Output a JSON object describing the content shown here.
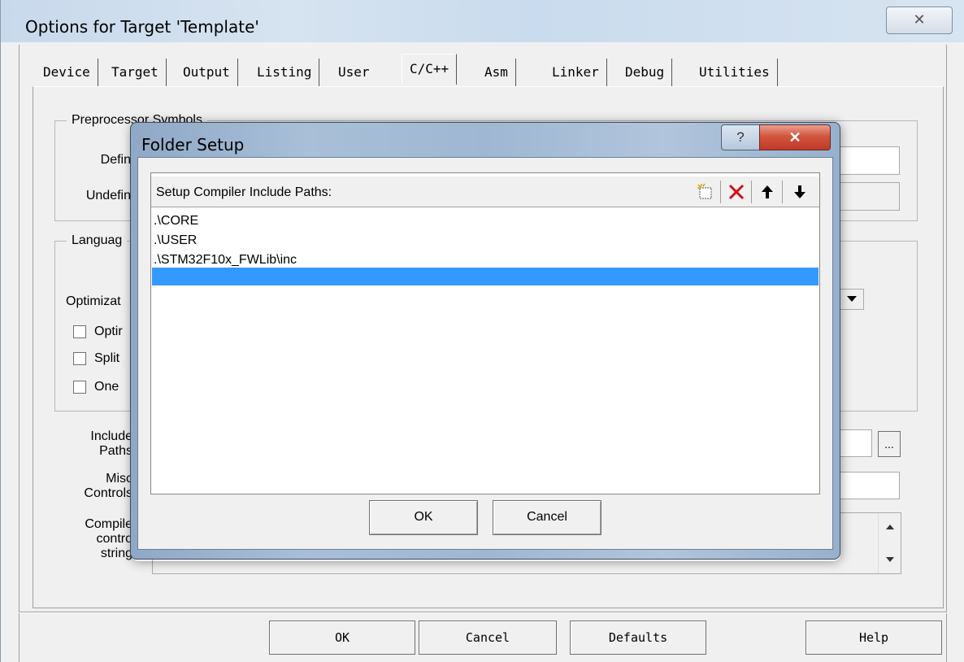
{
  "outer_dialog": {
    "title": "Options for Target 'Template'",
    "close_glyph": "✕",
    "tabs": [
      "Device",
      "Target",
      "Output",
      "Listing",
      "User",
      "C/C++",
      "Asm",
      "Linker",
      "Debug",
      "Utilities"
    ],
    "active_tab": "C/C++",
    "preprocessor_group": {
      "legend": "Preprocessor Symbols",
      "define_label": "Defin",
      "undefine_label": "Undefin"
    },
    "language_group": {
      "legend": "Languag",
      "optimization_label": "Optimizat",
      "checkboxes": [
        "Optir",
        "Split",
        "One"
      ]
    },
    "include_paths_label": [
      "Include",
      "Paths"
    ],
    "misc_controls_label": [
      "Misc",
      "Controls"
    ],
    "compiler_control_label": [
      "Compile",
      "contro",
      "string"
    ],
    "browse_button": "...",
    "buttons": {
      "ok": "OK",
      "cancel": "Cancel",
      "defaults": "Defaults",
      "help": "Help"
    }
  },
  "folder_setup": {
    "title": "Folder Setup",
    "help_glyph": "?",
    "close_glyph": "✕",
    "list_header": "Setup Compiler Include Paths:",
    "toolbar": {
      "new_icon": "new-folder-icon",
      "delete_icon": "delete-icon",
      "move_up_icon": "arrow-up-icon",
      "move_down_icon": "arrow-down-icon"
    },
    "paths": [
      ".\\CORE",
      ".\\USER",
      ".\\STM32F10x_FWLib\\inc",
      ""
    ],
    "selected_index": 3,
    "ok_label": "OK",
    "cancel_label": "Cancel"
  }
}
